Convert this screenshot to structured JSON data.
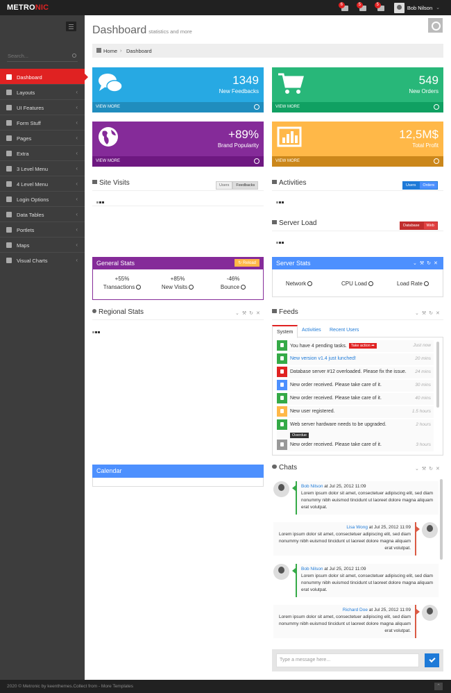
{
  "topbar": {
    "logo_main": "METRO",
    "logo_accent": "NIC",
    "notifications": [
      {
        "icon": "warning-icon",
        "badge": "6"
      },
      {
        "icon": "envelope-icon",
        "badge": "5"
      },
      {
        "icon": "tasks-icon",
        "badge": "5"
      }
    ],
    "user_name": "Bob Nilson"
  },
  "sidebar": {
    "search_placeholder": "Search...",
    "items": [
      {
        "label": "Dashboard",
        "icon": "home-icon",
        "active": true
      },
      {
        "label": "Layouts",
        "icon": "cogs-icon"
      },
      {
        "label": "UI Features",
        "icon": "bookmark-icon"
      },
      {
        "label": "Form Stuff",
        "icon": "table-icon"
      },
      {
        "label": "Pages",
        "icon": "briefcase-icon"
      },
      {
        "label": "Extra",
        "icon": "gift-icon"
      },
      {
        "label": "3 Level Menu",
        "icon": "sitemap-icon"
      },
      {
        "label": "4 Level Menu",
        "icon": "folder-icon"
      },
      {
        "label": "Login Options",
        "icon": "user-icon"
      },
      {
        "label": "Data Tables",
        "icon": "th-icon"
      },
      {
        "label": "Portlets",
        "icon": "file-icon"
      },
      {
        "label": "Maps",
        "icon": "map-marker-icon"
      },
      {
        "label": "Visual Charts",
        "icon": "bar-chart-icon"
      }
    ]
  },
  "header": {
    "title": "Dashboard",
    "subtitle": "statistics and more",
    "breadcrumb": [
      "Home",
      "Dashboard"
    ]
  },
  "stats": [
    {
      "number": "1349",
      "desc": "New Feedbacks",
      "more": "VIEW MORE",
      "color": "#27a9e3",
      "icon": "comments-icon"
    },
    {
      "number": "549",
      "desc": "New Orders",
      "more": "VIEW MORE",
      "color": "#28b779",
      "icon": "shopping-cart-icon"
    },
    {
      "number": "+89%",
      "desc": "Brand Popularity",
      "more": "VIEW MORE",
      "color": "#852b99",
      "icon": "globe-icon"
    },
    {
      "number": "12,5M$",
      "desc": "Total Profit",
      "more": "VIEW MORE",
      "color": "#ffb848",
      "icon": "bar-chart-icon"
    }
  ],
  "site_visits": {
    "title": "Site Visits",
    "buttons": [
      "Users",
      "Feedbacks"
    ]
  },
  "activities": {
    "title": "Activities",
    "buttons": [
      "Users",
      "Orders"
    ]
  },
  "server_load": {
    "title": "Server Load",
    "buttons": [
      "Database",
      "Web"
    ]
  },
  "general_stats": {
    "title": "General Stats",
    "reload": "Reload",
    "items": [
      {
        "value": "+55%",
        "label": "Transactions"
      },
      {
        "value": "+85%",
        "label": "New Visits"
      },
      {
        "value": "-46%",
        "label": "Bounce"
      }
    ]
  },
  "server_stats": {
    "title": "Server Stats",
    "items": [
      "Network",
      "CPU Load",
      "Load Rate"
    ]
  },
  "regional_stats": {
    "title": "Regional Stats"
  },
  "feeds": {
    "title": "Feeds",
    "tabs": [
      "System",
      "Activities",
      "Recent Users"
    ],
    "take_action": "Take action",
    "overdue": "Overdue",
    "items": [
      {
        "text": "You have 4 pending tasks.",
        "time": "Just now",
        "color": "#35aa47"
      },
      {
        "text": "New version v1.4 just lunched!",
        "time": "20 mins",
        "color": "#35aa47"
      },
      {
        "text": "Database server #12 overloaded. Please fix the issue.",
        "time": "24 mins",
        "color": "#e02222"
      },
      {
        "text": "New order received. Please take care of it.",
        "time": "30 mins",
        "color": "#4d90fe"
      },
      {
        "text": "New order received. Please take care of it.",
        "time": "40 mins",
        "color": "#35aa47"
      },
      {
        "text": "New user registered.",
        "time": "1.5 hours",
        "color": "#ffb848"
      },
      {
        "text": "Web server hardware needs to be upgraded.",
        "time": "2 hours",
        "color": "#35aa47"
      },
      {
        "text": "New order received. Please take care of it.",
        "time": "3 hours",
        "color": "#999999"
      }
    ]
  },
  "calendar": {
    "title": "Calendar"
  },
  "chats": {
    "title": "Chats",
    "input_placeholder": "Type a message here...",
    "messages": [
      {
        "name": "Bob Nilson",
        "at": "at Jul 25, 2012 11:09",
        "text": "Lorem ipsum dolor sit amet, consectetuer adipiscing elit, sed diam nonummy nibh euismod tincidunt ut laoreet dolore magna aliquam erat volutpat.",
        "dir": "in"
      },
      {
        "name": "Lisa Wong",
        "at": "at Jul 25, 2012 11:09",
        "text": "Lorem ipsum dolor sit amet, consectetuer adipiscing elit, sed diam nonummy nibh euismod tincidunt ut laoreet dolore magna aliquam erat volutpat.",
        "dir": "out"
      },
      {
        "name": "Bob Nilson",
        "at": "at Jul 25, 2012 11:09",
        "text": "Lorem ipsum dolor sit amet, consectetuer adipiscing elit, sed diam nonummy nibh euismod tincidunt ut laoreet dolore magna aliquam erat volutpat.",
        "dir": "in"
      },
      {
        "name": "Richard Doe",
        "at": "at Jul 25, 2012 11:09",
        "text": "Lorem ipsum dolor sit amet, consectetuer adipiscing elit, sed diam nonummy nibh euismod tincidunt ut laoreet dolore magna aliquam erat volutpat.",
        "dir": "out"
      }
    ]
  },
  "footer": {
    "text": "2020 © Metronic by keenthemes.Collect from - More Templates"
  }
}
